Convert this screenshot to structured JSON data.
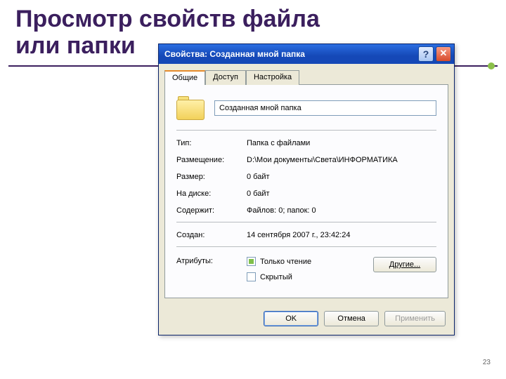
{
  "slide": {
    "title_line1": "Просмотр свойств файла",
    "title_line2": "или папки",
    "page_number": "23"
  },
  "dialog": {
    "title": "Свойства: Созданная мной папка",
    "tabs": {
      "general": "Общие",
      "access": "Доступ",
      "customize": "Настройка"
    },
    "name_value": "Созданная мной папка",
    "labels": {
      "type": "Тип:",
      "location": "Размещение:",
      "size": "Размер:",
      "on_disk": "На диске:",
      "contains": "Содержит:",
      "created": "Создан:",
      "attributes": "Атрибуты:"
    },
    "values": {
      "type": "Папка с файлами",
      "location": "D:\\Мои документы\\Света\\ИНФОРМАТИКА",
      "size": "0 байт",
      "on_disk": "0 байт",
      "contains": "Файлов: 0; папок: 0",
      "created": "14 сентября 2007 г., 23:42:24"
    },
    "attrs": {
      "readonly": "Только чтение",
      "hidden": "Скрытый"
    },
    "buttons": {
      "other": "Другие...",
      "ok": "OK",
      "cancel": "Отмена",
      "apply": "Применить"
    }
  }
}
